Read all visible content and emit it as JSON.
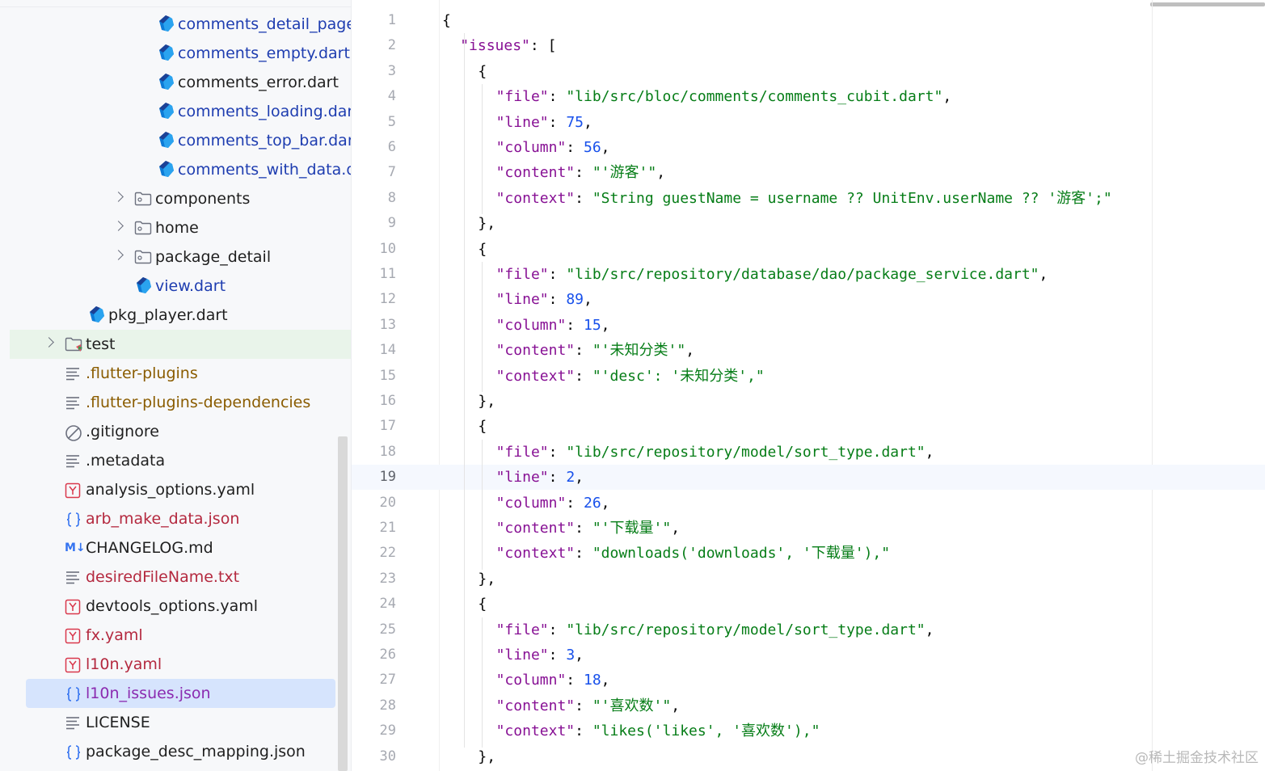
{
  "sidebar": {
    "items": [
      {
        "label": "comments_detail_page",
        "icon": "dart-icon",
        "color": "blue",
        "indent": 3
      },
      {
        "label": "comments_empty.dart",
        "icon": "dart-icon",
        "color": "blue",
        "indent": 3
      },
      {
        "label": "comments_error.dart",
        "icon": "dart-icon",
        "color": "dark",
        "indent": 3
      },
      {
        "label": "comments_loading.dar",
        "icon": "dart-icon",
        "color": "blue",
        "indent": 3
      },
      {
        "label": "comments_top_bar.dar",
        "icon": "dart-icon",
        "color": "blue",
        "indent": 3
      },
      {
        "label": "comments_with_data.d",
        "icon": "dart-icon",
        "color": "blue",
        "indent": 3
      },
      {
        "label": "components",
        "icon": "folder-icon",
        "color": "dark",
        "indent": 2,
        "expandable": true
      },
      {
        "label": "home",
        "icon": "folder-icon",
        "color": "dark",
        "indent": 2,
        "expandable": true
      },
      {
        "label": "package_detail",
        "icon": "folder-icon",
        "color": "dark",
        "indent": 2,
        "expandable": true
      },
      {
        "label": "view.dart",
        "icon": "dart-icon",
        "color": "blue",
        "indent": 2
      },
      {
        "label": "pkg_player.dart",
        "icon": "dart-icon",
        "color": "dark",
        "indent": 1
      },
      {
        "label": "test",
        "icon": "test-folder-icon",
        "color": "dark",
        "indent": 0,
        "expandable": true,
        "highlight": "green"
      },
      {
        "label": ".flutter-plugins",
        "icon": "text-file-icon",
        "color": "olive",
        "indent": 0
      },
      {
        "label": ".flutter-plugins-dependencies",
        "icon": "text-file-icon",
        "color": "olive",
        "indent": 0
      },
      {
        "label": ".gitignore",
        "icon": "ignore-icon",
        "color": "dark",
        "indent": 0
      },
      {
        "label": ".metadata",
        "icon": "text-file-icon",
        "color": "dark",
        "indent": 0
      },
      {
        "label": "analysis_options.yaml",
        "icon": "yaml-icon",
        "color": "dark",
        "indent": 0
      },
      {
        "label": "arb_make_data.json",
        "icon": "json-icon",
        "color": "red",
        "indent": 0
      },
      {
        "label": "CHANGELOG.md",
        "icon": "markdown-icon",
        "color": "dark",
        "indent": 0
      },
      {
        "label": "desiredFileName.txt",
        "icon": "text-file-icon",
        "color": "red",
        "indent": 0
      },
      {
        "label": "devtools_options.yaml",
        "icon": "yaml-icon",
        "color": "dark",
        "indent": 0
      },
      {
        "label": "fx.yaml",
        "icon": "yaml-icon",
        "color": "red",
        "indent": 0
      },
      {
        "label": "l10n.yaml",
        "icon": "yaml-icon",
        "color": "red",
        "indent": 0
      },
      {
        "label": "l10n_issues.json",
        "icon": "json-icon",
        "color": "purple",
        "indent": 0,
        "selected": true
      },
      {
        "label": "LICENSE",
        "icon": "text-file-icon",
        "color": "dark",
        "indent": 0
      },
      {
        "label": "package_desc_mapping.json",
        "icon": "json-icon",
        "color": "dark",
        "indent": 0
      }
    ],
    "markdown_badge": "M↓",
    "yaml_badge": "Y",
    "json_badge": "{}"
  },
  "editor": {
    "current_line": 19,
    "lines": [
      {
        "n": "1",
        "indent": 0,
        "tokens": [
          {
            "t": "{",
            "c": "pun"
          }
        ]
      },
      {
        "n": "2",
        "indent": 1,
        "tokens": [
          {
            "t": "\"issues\"",
            "c": "key"
          },
          {
            "t": ": [",
            "c": "pun"
          }
        ]
      },
      {
        "n": "3",
        "indent": 2,
        "tokens": [
          {
            "t": "{",
            "c": "pun"
          }
        ]
      },
      {
        "n": "4",
        "indent": 3,
        "tokens": [
          {
            "t": "\"file\"",
            "c": "key"
          },
          {
            "t": ": ",
            "c": "pun"
          },
          {
            "t": "\"lib/src/bloc/comments/comments_cubit.dart\"",
            "c": "str"
          },
          {
            "t": ",",
            "c": "pun"
          }
        ]
      },
      {
        "n": "5",
        "indent": 3,
        "tokens": [
          {
            "t": "\"line\"",
            "c": "key"
          },
          {
            "t": ": ",
            "c": "pun"
          },
          {
            "t": "75",
            "c": "num"
          },
          {
            "t": ",",
            "c": "pun"
          }
        ]
      },
      {
        "n": "6",
        "indent": 3,
        "tokens": [
          {
            "t": "\"column\"",
            "c": "key"
          },
          {
            "t": ": ",
            "c": "pun"
          },
          {
            "t": "56",
            "c": "num"
          },
          {
            "t": ",",
            "c": "pun"
          }
        ]
      },
      {
        "n": "7",
        "indent": 3,
        "tokens": [
          {
            "t": "\"content\"",
            "c": "key"
          },
          {
            "t": ": ",
            "c": "pun"
          },
          {
            "t": "\"'游客'\"",
            "c": "str"
          },
          {
            "t": ",",
            "c": "pun"
          }
        ]
      },
      {
        "n": "8",
        "indent": 3,
        "tokens": [
          {
            "t": "\"context\"",
            "c": "key"
          },
          {
            "t": ": ",
            "c": "pun"
          },
          {
            "t": "\"String guestName = username ?? UnitEnv.userName ?? '游客';\"",
            "c": "str"
          }
        ]
      },
      {
        "n": "9",
        "indent": 2,
        "tokens": [
          {
            "t": "},",
            "c": "pun"
          }
        ]
      },
      {
        "n": "10",
        "indent": 2,
        "tokens": [
          {
            "t": "{",
            "c": "pun"
          }
        ]
      },
      {
        "n": "11",
        "indent": 3,
        "tokens": [
          {
            "t": "\"file\"",
            "c": "key"
          },
          {
            "t": ": ",
            "c": "pun"
          },
          {
            "t": "\"lib/src/repository/database/dao/package_service.dart\"",
            "c": "str"
          },
          {
            "t": ",",
            "c": "pun"
          }
        ]
      },
      {
        "n": "12",
        "indent": 3,
        "tokens": [
          {
            "t": "\"line\"",
            "c": "key"
          },
          {
            "t": ": ",
            "c": "pun"
          },
          {
            "t": "89",
            "c": "num"
          },
          {
            "t": ",",
            "c": "pun"
          }
        ]
      },
      {
        "n": "13",
        "indent": 3,
        "tokens": [
          {
            "t": "\"column\"",
            "c": "key"
          },
          {
            "t": ": ",
            "c": "pun"
          },
          {
            "t": "15",
            "c": "num"
          },
          {
            "t": ",",
            "c": "pun"
          }
        ]
      },
      {
        "n": "14",
        "indent": 3,
        "tokens": [
          {
            "t": "\"content\"",
            "c": "key"
          },
          {
            "t": ": ",
            "c": "pun"
          },
          {
            "t": "\"'未知分类'\"",
            "c": "str"
          },
          {
            "t": ",",
            "c": "pun"
          }
        ]
      },
      {
        "n": "15",
        "indent": 3,
        "tokens": [
          {
            "t": "\"context\"",
            "c": "key"
          },
          {
            "t": ": ",
            "c": "pun"
          },
          {
            "t": "\"'desc': '未知分类',\"",
            "c": "str"
          }
        ]
      },
      {
        "n": "16",
        "indent": 2,
        "tokens": [
          {
            "t": "},",
            "c": "pun"
          }
        ]
      },
      {
        "n": "17",
        "indent": 2,
        "tokens": [
          {
            "t": "{",
            "c": "pun"
          }
        ]
      },
      {
        "n": "18",
        "indent": 3,
        "tokens": [
          {
            "t": "\"file\"",
            "c": "key"
          },
          {
            "t": ": ",
            "c": "pun"
          },
          {
            "t": "\"lib/src/repository/model/sort_type.dart\"",
            "c": "str"
          },
          {
            "t": ",",
            "c": "pun"
          }
        ]
      },
      {
        "n": "19",
        "indent": 3,
        "tokens": [
          {
            "t": "\"line\"",
            "c": "key"
          },
          {
            "t": ": ",
            "c": "pun"
          },
          {
            "t": "2",
            "c": "num"
          },
          {
            "t": ",",
            "c": "pun"
          }
        ]
      },
      {
        "n": "20",
        "indent": 3,
        "tokens": [
          {
            "t": "\"column\"",
            "c": "key"
          },
          {
            "t": ": ",
            "c": "pun"
          },
          {
            "t": "26",
            "c": "num"
          },
          {
            "t": ",",
            "c": "pun"
          }
        ]
      },
      {
        "n": "21",
        "indent": 3,
        "tokens": [
          {
            "t": "\"content\"",
            "c": "key"
          },
          {
            "t": ": ",
            "c": "pun"
          },
          {
            "t": "\"'下载量'\"",
            "c": "str"
          },
          {
            "t": ",",
            "c": "pun"
          }
        ]
      },
      {
        "n": "22",
        "indent": 3,
        "tokens": [
          {
            "t": "\"context\"",
            "c": "key"
          },
          {
            "t": ": ",
            "c": "pun"
          },
          {
            "t": "\"downloads('downloads', '下载量'),\"",
            "c": "str"
          }
        ]
      },
      {
        "n": "23",
        "indent": 2,
        "tokens": [
          {
            "t": "},",
            "c": "pun"
          }
        ]
      },
      {
        "n": "24",
        "indent": 2,
        "tokens": [
          {
            "t": "{",
            "c": "pun"
          }
        ]
      },
      {
        "n": "25",
        "indent": 3,
        "tokens": [
          {
            "t": "\"file\"",
            "c": "key"
          },
          {
            "t": ": ",
            "c": "pun"
          },
          {
            "t": "\"lib/src/repository/model/sort_type.dart\"",
            "c": "str"
          },
          {
            "t": ",",
            "c": "pun"
          }
        ]
      },
      {
        "n": "26",
        "indent": 3,
        "tokens": [
          {
            "t": "\"line\"",
            "c": "key"
          },
          {
            "t": ": ",
            "c": "pun"
          },
          {
            "t": "3",
            "c": "num"
          },
          {
            "t": ",",
            "c": "pun"
          }
        ]
      },
      {
        "n": "27",
        "indent": 3,
        "tokens": [
          {
            "t": "\"column\"",
            "c": "key"
          },
          {
            "t": ": ",
            "c": "pun"
          },
          {
            "t": "18",
            "c": "num"
          },
          {
            "t": ",",
            "c": "pun"
          }
        ]
      },
      {
        "n": "28",
        "indent": 3,
        "tokens": [
          {
            "t": "\"content\"",
            "c": "key"
          },
          {
            "t": ": ",
            "c": "pun"
          },
          {
            "t": "\"'喜欢数'\"",
            "c": "str"
          },
          {
            "t": ",",
            "c": "pun"
          }
        ]
      },
      {
        "n": "29",
        "indent": 3,
        "tokens": [
          {
            "t": "\"context\"",
            "c": "key"
          },
          {
            "t": ": ",
            "c": "pun"
          },
          {
            "t": "\"likes('likes', '喜欢数'),\"",
            "c": "str"
          }
        ]
      },
      {
        "n": "30",
        "indent": 2,
        "tokens": [
          {
            "t": "},",
            "c": "pun"
          }
        ]
      }
    ]
  },
  "watermark": "@稀土掘金技术社区",
  "colors": {
    "dart_blue": "#0c7ad6",
    "dart_dark": "#1d3b8f",
    "label_blue": "#1e3db0",
    "label_olive": "#8a5c00",
    "label_red": "#b4293f",
    "label_purple": "#8b2bb0",
    "json_key": "#871094",
    "json_string": "#067d17",
    "json_number": "#1750eb",
    "selection": "#d6e4fd",
    "test_highlight": "#e9f4ea"
  }
}
